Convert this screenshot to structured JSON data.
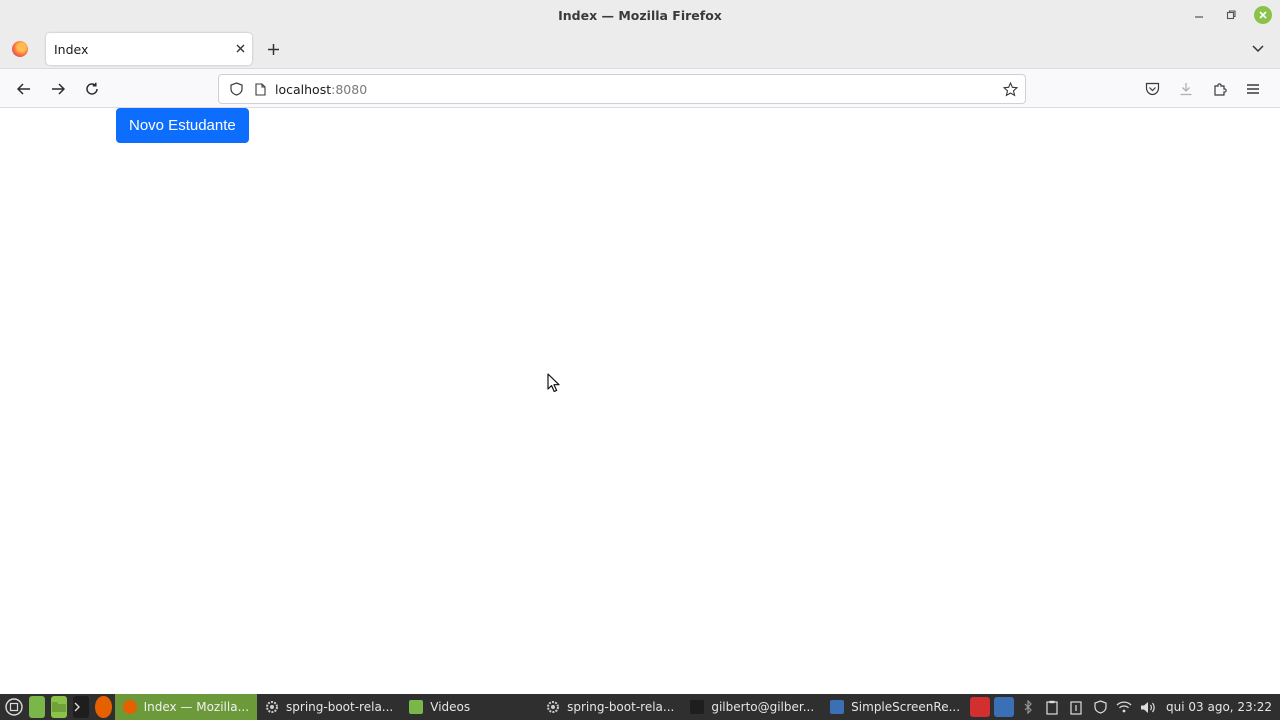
{
  "window": {
    "title": "Index — Mozilla Firefox"
  },
  "tabs": [
    {
      "label": "Index"
    }
  ],
  "urlbar": {
    "host": "localhost",
    "port": ":8080"
  },
  "page": {
    "new_student_button": "Novo Estudante"
  },
  "taskbar": {
    "tasks": [
      {
        "label": "Index — Mozilla..."
      },
      {
        "label": "spring-boot-rela..."
      },
      {
        "label": "Videos"
      },
      {
        "label": "spring-boot-rela..."
      },
      {
        "label": "gilberto@gilber..."
      },
      {
        "label": "SimpleScreenRe..."
      }
    ],
    "clock": "qui 03 ago, 23:22"
  },
  "colors": {
    "primary": "#0d6efd",
    "active_task": "#6c9a3a",
    "taskbar_bg": "#2f2f2f"
  }
}
